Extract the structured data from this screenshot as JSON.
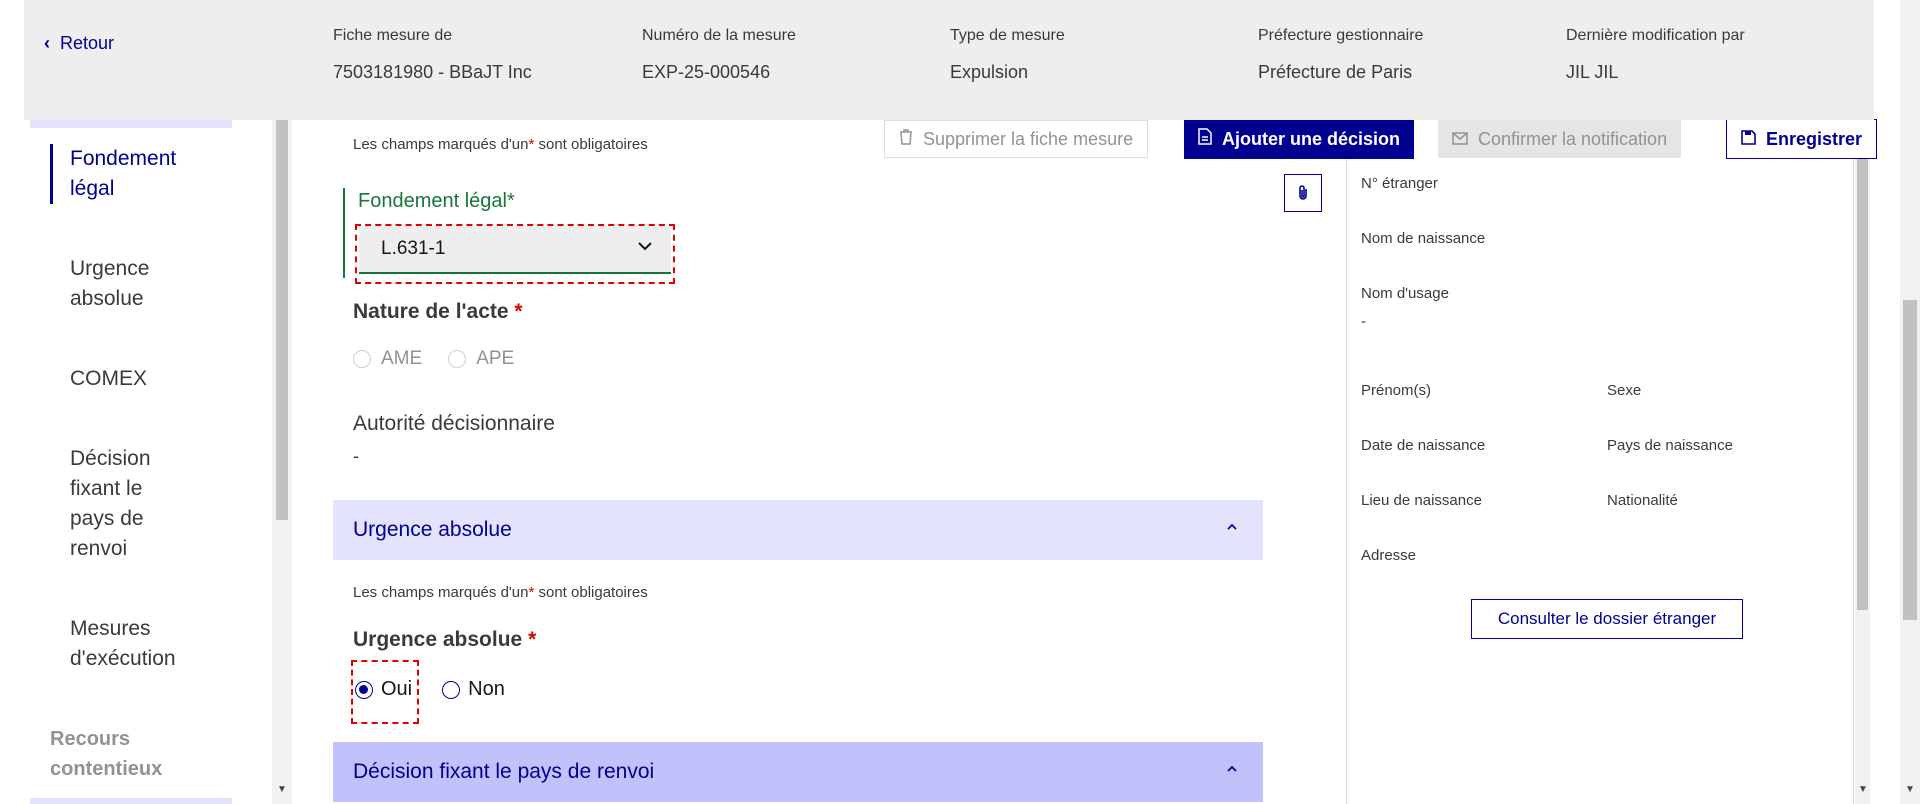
{
  "header": {
    "back_label": "Retour",
    "columns": [
      {
        "label": "Fiche mesure de",
        "value": "7503181980 - BBaJT Inc"
      },
      {
        "label": "Numéro de la mesure",
        "value": "EXP-25-000546"
      },
      {
        "label": "Type de mesure",
        "value": "Expulsion"
      },
      {
        "label": "Préfecture gestionnaire",
        "value": "Préfecture de Paris"
      },
      {
        "label": "Dernière modification par",
        "value": "JIL JIL"
      }
    ]
  },
  "sidebar": {
    "items": [
      {
        "label": "Fondement légal",
        "active": true
      },
      {
        "label": "Urgence absolue"
      },
      {
        "label": "COMEX"
      },
      {
        "label": "Décision fixant le pays de renvoi"
      },
      {
        "label": "Mesures d'exécution"
      }
    ],
    "group_label": "Recours contentieux"
  },
  "toolbar": {
    "delete_label": "Supprimer la fiche mesure",
    "add_decision_label": "Ajouter une décision",
    "confirm_notification_label": "Confirmer la notification",
    "save_label": "Enregistrer",
    "partial_heading_tail": "le"
  },
  "form": {
    "required_note_prefix": "Les champs marqués d'un",
    "required_star": "*",
    "required_note_suffix": "sont obligatoires",
    "fondement": {
      "label": "Fondement légal",
      "star": "*",
      "value": "L.631-1"
    },
    "nature": {
      "label": "Nature de l'acte",
      "star": "*",
      "options": [
        "AME",
        "APE"
      ]
    },
    "autorite": {
      "label": "Autorité décisionnaire",
      "value": "-"
    },
    "urgence_section": {
      "title": "Urgence absolue"
    },
    "urgence": {
      "label": "Urgence absolue",
      "star": "*",
      "options": [
        "Oui",
        "Non"
      ],
      "selected": "Oui"
    },
    "pays_section": {
      "title": "Décision fixant le pays de renvoi"
    }
  },
  "identity_panel": {
    "n_etranger": "N° étranger",
    "nom_naissance": "Nom de naissance",
    "nom_usage": "Nom d'usage",
    "nom_usage_value": "-",
    "prenoms": "Prénom(s)",
    "sexe": "Sexe",
    "date_naissance": "Date de naissance",
    "pays_naissance": "Pays de naissance",
    "lieu_naissance": "Lieu de naissance",
    "nationalite": "Nationalité",
    "adresse": "Adresse",
    "consult_label": "Consulter le dossier étranger"
  },
  "colors": {
    "primary": "#000091",
    "section_light": "#e3e3fd",
    "section_strong": "#c1c1fb",
    "success": "#18753c",
    "required": "#ce0500"
  }
}
